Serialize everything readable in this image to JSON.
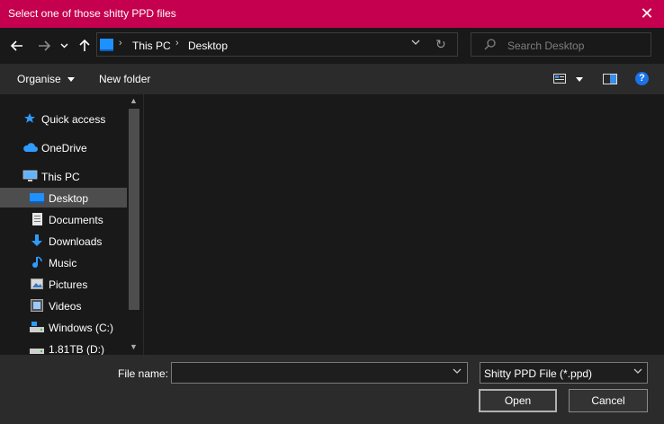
{
  "window": {
    "title": "Select one of those shitty PPD files",
    "close_glyph": "✕"
  },
  "nav_buttons": {
    "back": "←",
    "forward": "→",
    "recent": "⌄",
    "up": "↑"
  },
  "address": {
    "crumbs": [
      "This PC",
      "Desktop"
    ],
    "separator": "›",
    "refresh_glyph": "↻"
  },
  "search": {
    "placeholder": "Search Desktop"
  },
  "toolbar": {
    "organise_label": "Organise",
    "new_folder_label": "New folder",
    "help_glyph": "?"
  },
  "sidebar": {
    "items": [
      {
        "label": "Quick access",
        "icon": "star-icon"
      },
      {
        "label": "OneDrive",
        "icon": "cloud-icon"
      },
      {
        "label": "This PC",
        "icon": "computer-icon"
      },
      {
        "label": "Desktop",
        "icon": "desktop-icon",
        "selected": true
      },
      {
        "label": "Documents",
        "icon": "document-icon"
      },
      {
        "label": "Downloads",
        "icon": "download-icon"
      },
      {
        "label": "Music",
        "icon": "music-icon"
      },
      {
        "label": "Pictures",
        "icon": "pictures-icon"
      },
      {
        "label": "Videos",
        "icon": "videos-icon"
      },
      {
        "label": "Windows (C:)",
        "icon": "drive-icon"
      },
      {
        "label": "1.81TB (D:)",
        "icon": "drive-icon"
      }
    ]
  },
  "bottom": {
    "file_name_label": "File name:",
    "file_name_value": "",
    "filter_value": "Shitty PPD File (*.ppd)",
    "open_label": "Open",
    "cancel_label": "Cancel"
  },
  "colors": {
    "titlebar": "#c5004f",
    "accent_blue": "#1e90ff",
    "help_blue": "#1a73e8"
  }
}
